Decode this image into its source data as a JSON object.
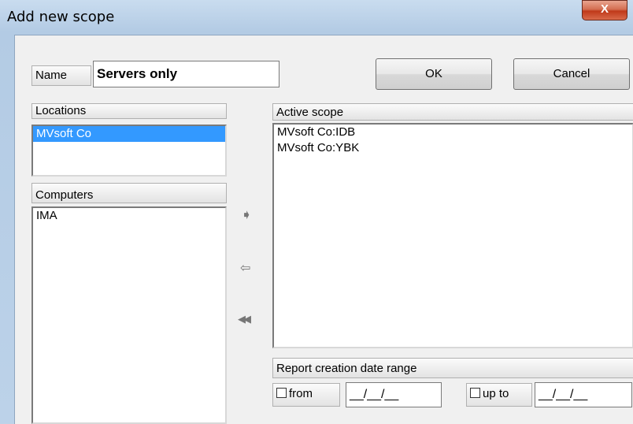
{
  "window": {
    "title": "Add new scope",
    "close_glyph": "X"
  },
  "name_field": {
    "label": "Name",
    "value": "Servers only"
  },
  "buttons": {
    "ok": "OK",
    "cancel": "Cancel"
  },
  "locations": {
    "header": "Locations",
    "items": [
      "MVsoft Co"
    ]
  },
  "computers": {
    "header": "Computers",
    "items": [
      "IMA"
    ]
  },
  "active_scope": {
    "header": "Active scope",
    "items": [
      "MVsoft Co:IDB",
      "MVsoft Co:YBK"
    ]
  },
  "arrows": {
    "add": "➧",
    "remove": "⇦",
    "remove_all": "◀◀"
  },
  "date_range": {
    "header": "Report creation date range",
    "from_label": "from",
    "from_value": "__/__/__",
    "upto_label": "up to",
    "upto_value": "__/__/__"
  }
}
